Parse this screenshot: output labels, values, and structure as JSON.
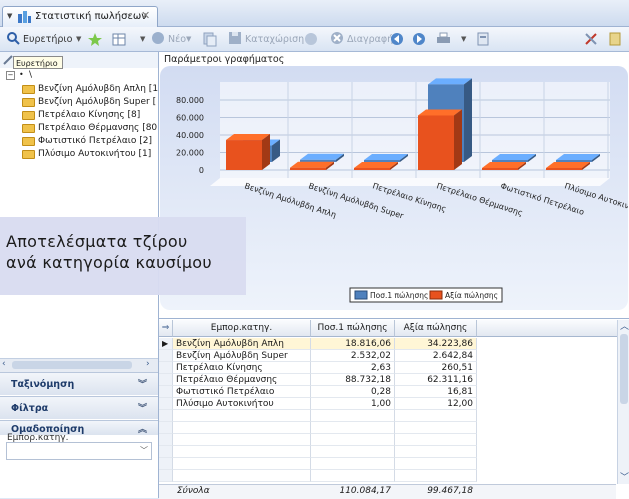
{
  "window": {
    "tab_title": "Στατιστική πωλήσεων",
    "tab_close": "✕"
  },
  "toolbar": {
    "index_label": "Ευρετήριο",
    "new_label": "Νέο",
    "save_label": "Καταχώριση",
    "delete_label": "Διαγραφή"
  },
  "tooltip": {
    "text": "Ευρετήριο"
  },
  "tree": {
    "root_label": "\\",
    "items": [
      {
        "label": "Βενζίνη Αμόλυβδη Απλη [1"
      },
      {
        "label": "Βενζίνη Αμόλυβδη Super ["
      },
      {
        "label": "Πετρέλαιο Κίνησης [8]"
      },
      {
        "label": "Πετρέλαιο Θέρμανσης [80"
      },
      {
        "label": "Φωτιστικό Πετρέλαιο [2]"
      },
      {
        "label": "Πλύσιμο Αυτοκινήτου [1]"
      }
    ]
  },
  "sections": {
    "sort_label": "Ταξινόμηση",
    "filters_label": "Φίλτρα",
    "grouping_label": "Ομαδοποίηση",
    "grouping_field": "Εμπορ.κατηγ."
  },
  "overlay": {
    "line1": "Αποτελέσματα τζίρου",
    "line2": "ανά κατηγορία καυσίμου"
  },
  "chart_title": "Παράμετροι γραφήματος",
  "chart_data": {
    "type": "bar",
    "categories": [
      "Βενζίνη Αμόλυβδη Απλη",
      "Βενζίνη Αμόλυβδη Super",
      "Πετρέλαιο Κίνησης",
      "Πετρέλαιο Θέρμανσης",
      "Φωτιστικό Πετρέλαιο",
      "Πλύσιμο Αυτοκινήτου"
    ],
    "series": [
      {
        "name": "Ποσ.1 πώλησης",
        "color": "#4f81bd",
        "values": [
          18816.06,
          2532.02,
          2.63,
          88732.18,
          0.28,
          1.0
        ]
      },
      {
        "name": "Αξία πώλησης",
        "color": "#e8521e",
        "values": [
          34223.86,
          2642.84,
          260.51,
          62311.16,
          16.81,
          12.0
        ]
      }
    ],
    "y_ticks": [
      "0",
      "20.000",
      "40.000",
      "60.000",
      "80.000"
    ],
    "ylim": [
      0,
      80000
    ],
    "grid": true,
    "legend": "bottom-right"
  },
  "grid": {
    "columns": [
      "Εμπορ.κατηγ.",
      "Ποσ.1 πώλησης",
      "Αξία πώλησης"
    ],
    "rows": [
      {
        "cat": "Βενζίνη Αμόλυβδη Απλη",
        "qty": "18.816,06",
        "val": "34.223,86"
      },
      {
        "cat": "Βενζίνη Αμόλυβδη Super",
        "qty": "2.532,02",
        "val": "2.642,84"
      },
      {
        "cat": "Πετρέλαιο Κίνησης",
        "qty": "2,63",
        "val": "260,51"
      },
      {
        "cat": "Πετρέλαιο Θέρμανσης",
        "qty": "88.732,18",
        "val": "62.311,16"
      },
      {
        "cat": "Φωτιστικό Πετρέλαιο",
        "qty": "0,28",
        "val": "16,81"
      },
      {
        "cat": "Πλύσιμο Αυτοκινήτου",
        "qty": "1,00",
        "val": "12,00"
      }
    ],
    "footer": {
      "label": "Σύνολα",
      "qty": "110.084,17",
      "val": "99.467,18"
    }
  }
}
